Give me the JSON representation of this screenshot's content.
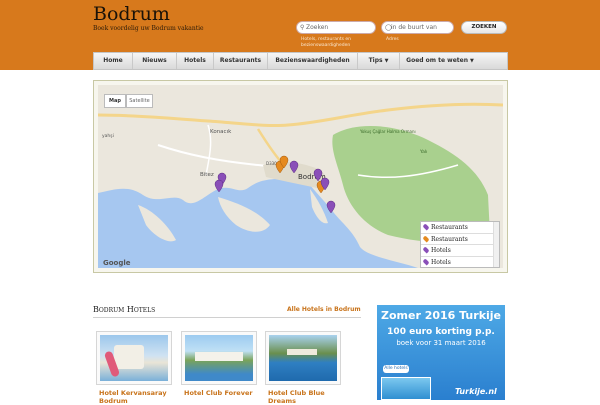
{
  "header": {
    "title": "Bodrum",
    "tagline": "Boek voordelig uw Bodrum vakantie",
    "search_placeholder": "Zoeken",
    "near_placeholder": "in de buurt van",
    "search_button": "ZOEKEN",
    "search_hint": "Hotels, restaurants en bezienswaardigheden",
    "near_hint": "Adres"
  },
  "nav": {
    "items": [
      {
        "label": "Home",
        "dropdown": false
      },
      {
        "label": "Nieuws",
        "dropdown": false
      },
      {
        "label": "Hotels",
        "dropdown": false
      },
      {
        "label": "Restaurants",
        "dropdown": false
      },
      {
        "label": "Bezienswaardigheden",
        "dropdown": false
      },
      {
        "label": "Tips",
        "dropdown": true
      },
      {
        "label": "Goed om te weten",
        "dropdown": true
      }
    ]
  },
  "map": {
    "map_button": "Map",
    "satellite_button": "Satellite",
    "logo": "Google",
    "labels": {
      "konacik": "Konacık",
      "bitez": "Bitez",
      "bodrum": "Bodrum",
      "yakakoy": "Yokuş Çağlar Halma Ormanı",
      "yali": "Yalı",
      "yahsi": "yahşi",
      "road": "D330"
    },
    "legend": [
      {
        "label": "Restaurants",
        "color": "#8a4fb8"
      },
      {
        "label": "Restaurants",
        "color": "#e58a1f"
      },
      {
        "label": "Hotels",
        "color": "#8a4fb8"
      },
      {
        "label": "Hotels",
        "color": "#8a4fb8"
      }
    ]
  },
  "hotels": {
    "title": "Bodrum Hotels",
    "all_link": "Alle Hotels in Bodrum",
    "items": [
      {
        "name": "Hotel Kervansaray Bodrum"
      },
      {
        "name": "Hotel Club Forever"
      },
      {
        "name": "Hotel Club Blue Dreams"
      }
    ]
  },
  "ad": {
    "headline": "Zomer 2016 Turkije",
    "discount": "100 euro korting p.p.",
    "deadline": "boek voor 31 maart 2016",
    "button": "Alle hotels",
    "brand": "Turkije.nl"
  },
  "colors": {
    "header_bg": "#d7791c",
    "link": "#c8731a",
    "pin_purple": "#8a4fb8",
    "pin_orange": "#e58a1f"
  }
}
